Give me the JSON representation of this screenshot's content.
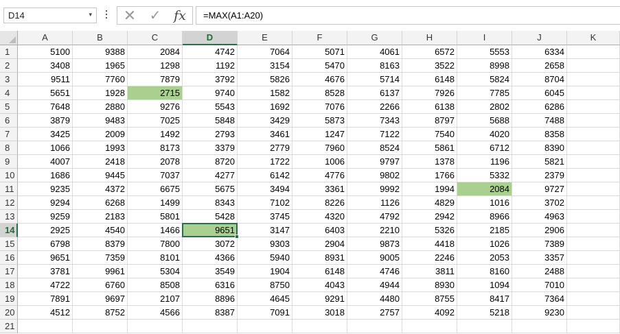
{
  "name_box": {
    "value": "D14",
    "dropdown_glyph": "▾"
  },
  "formula_bar": {
    "cancel_glyph": "✕",
    "enter_glyph": "✓",
    "function_glyph": "fx",
    "formula": "=MAX(A1:A20)"
  },
  "sheet": {
    "columns": [
      "A",
      "B",
      "C",
      "D",
      "E",
      "F",
      "G",
      "H",
      "I",
      "J",
      "K"
    ],
    "row_numbers": [
      "1",
      "2",
      "3",
      "4",
      "5",
      "6",
      "7",
      "8",
      "9",
      "10",
      "11",
      "12",
      "13",
      "14",
      "15",
      "16",
      "17",
      "18",
      "19",
      "20",
      "21"
    ],
    "selected_column": "D",
    "selected_row": "14",
    "highlight_color": "#a9d08e",
    "selection_color": "#217346",
    "highlighted_cells": [
      "C4",
      "D14",
      "I11"
    ],
    "rows": [
      [
        "5100",
        "9388",
        "2084",
        "4742",
        "7064",
        "5071",
        "4061",
        "6572",
        "5553",
        "6334"
      ],
      [
        "3408",
        "1965",
        "1298",
        "1192",
        "3154",
        "5470",
        "8163",
        "3522",
        "8998",
        "2658"
      ],
      [
        "9511",
        "7760",
        "7879",
        "3792",
        "5826",
        "4676",
        "5714",
        "6148",
        "5824",
        "8704"
      ],
      [
        "5651",
        "1928",
        "2715",
        "9740",
        "1582",
        "8528",
        "6137",
        "7926",
        "7785",
        "6045"
      ],
      [
        "7648",
        "2880",
        "9276",
        "5543",
        "1692",
        "7076",
        "2266",
        "6138",
        "2802",
        "6286"
      ],
      [
        "3879",
        "9483",
        "7025",
        "5848",
        "3429",
        "5873",
        "7343",
        "8797",
        "5688",
        "7488"
      ],
      [
        "3425",
        "2009",
        "1492",
        "2793",
        "3461",
        "1247",
        "7122",
        "7540",
        "4020",
        "8358"
      ],
      [
        "1066",
        "1993",
        "8173",
        "3379",
        "2779",
        "7960",
        "8524",
        "5861",
        "6712",
        "8390"
      ],
      [
        "4007",
        "2418",
        "2078",
        "8720",
        "1722",
        "1006",
        "9797",
        "1378",
        "1196",
        "5821"
      ],
      [
        "1686",
        "9445",
        "7037",
        "4277",
        "6142",
        "4776",
        "9802",
        "1766",
        "5332",
        "2379"
      ],
      [
        "9235",
        "4372",
        "6675",
        "5675",
        "3494",
        "3361",
        "9992",
        "1994",
        "2084",
        "9727"
      ],
      [
        "9294",
        "6268",
        "1499",
        "8343",
        "7102",
        "8226",
        "1126",
        "4829",
        "1016",
        "3702"
      ],
      [
        "9259",
        "2183",
        "5801",
        "5428",
        "3745",
        "4320",
        "4792",
        "2942",
        "8966",
        "4963"
      ],
      [
        "2925",
        "4540",
        "1466",
        "9651",
        "3147",
        "6403",
        "2210",
        "5326",
        "2185",
        "2906"
      ],
      [
        "6798",
        "8379",
        "7800",
        "3072",
        "9303",
        "2904",
        "9873",
        "4418",
        "1026",
        "7389"
      ],
      [
        "9651",
        "7359",
        "8101",
        "4366",
        "5940",
        "8931",
        "9005",
        "2246",
        "2053",
        "3357"
      ],
      [
        "3781",
        "9961",
        "5304",
        "3549",
        "1904",
        "6148",
        "4746",
        "3811",
        "8160",
        "2488"
      ],
      [
        "4722",
        "6760",
        "8508",
        "6316",
        "8750",
        "4043",
        "4944",
        "8930",
        "1094",
        "7010"
      ],
      [
        "7891",
        "9697",
        "2107",
        "8896",
        "4645",
        "9291",
        "4480",
        "8755",
        "8417",
        "7364"
      ],
      [
        "4512",
        "8752",
        "4566",
        "8387",
        "7091",
        "3018",
        "2757",
        "4092",
        "5218",
        "9230"
      ],
      [
        "",
        "",
        "",
        "",
        "",
        "",
        "",
        "",
        "",
        ""
      ]
    ]
  }
}
